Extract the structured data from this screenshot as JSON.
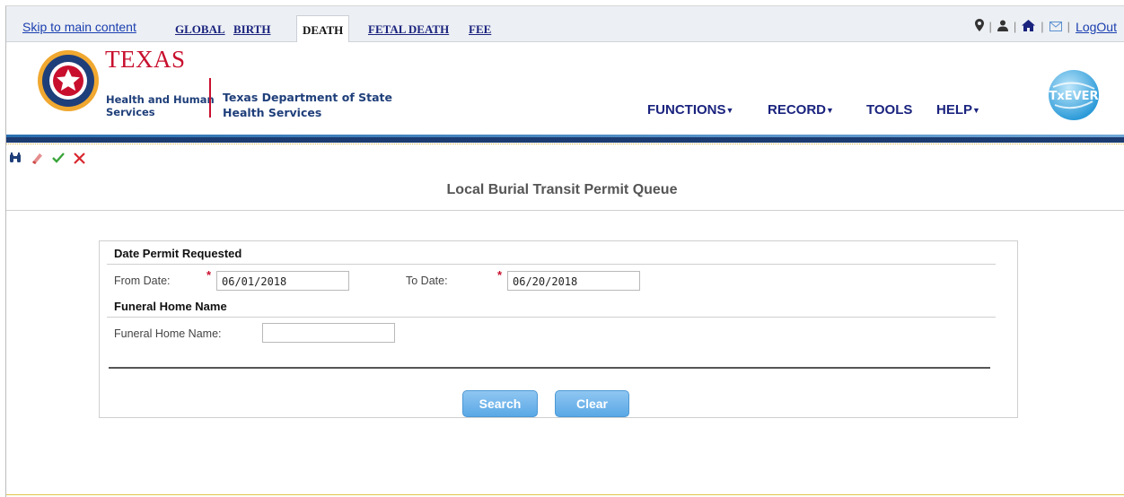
{
  "topbar": {
    "skip_link": "Skip to main content",
    "tabs": [
      "GLOBAL",
      "BIRTH",
      "DEATH",
      "FETAL DEATH",
      "FEE"
    ],
    "active_tab": "DEATH",
    "logout": "LogOut"
  },
  "header": {
    "org_name": "TEXAS",
    "org_sub1": "Health and Human",
    "org_sub2": "Services",
    "dept_line1": "Texas Department of State",
    "dept_line2": "Health Services",
    "menu": {
      "functions": "FUNCTIONS",
      "record": "RECORD",
      "tools": "TOOLS",
      "help": "HELP"
    },
    "brand_badge": "TxEVER"
  },
  "page": {
    "title": "Local Burial Transit Permit Queue"
  },
  "form": {
    "section1_title": "Date Permit Requested",
    "from_label": "From Date:",
    "from_value": "06/01/2018",
    "to_label": "To Date:",
    "to_value": "06/20/2018",
    "section2_title": "Funeral Home Name",
    "funeral_label": "Funeral Home Name:",
    "funeral_value": "",
    "required_mark": "*"
  },
  "buttons": {
    "search": "Search",
    "clear": "Clear"
  },
  "colors": {
    "accent_blue": "#1c3b70",
    "brand_red": "#c8102e",
    "button_blue": "#5aa8e6"
  }
}
